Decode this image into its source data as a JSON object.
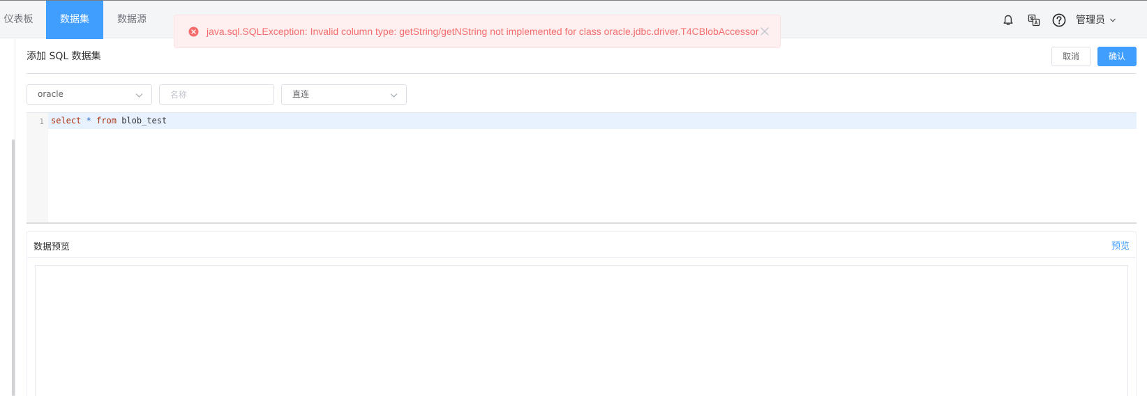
{
  "nav": {
    "tabs": [
      {
        "label": "仪表板",
        "active": false
      },
      {
        "label": "数据集",
        "active": true
      },
      {
        "label": "数据源",
        "active": false
      }
    ]
  },
  "header_tools": {
    "icons": [
      "bell-icon",
      "translate-icon",
      "help-icon"
    ],
    "user_label": "管理员"
  },
  "toast": {
    "type": "error",
    "message": "java.sql.SQLException: Invalid column type: getString/getNString not implemented for class oracle.jdbc.driver.T4CBlobAccessor"
  },
  "page": {
    "title": "添加 SQL 数据集",
    "cancel_label": "取消",
    "confirm_label": "确认"
  },
  "form": {
    "datasource_value": "oracle",
    "name_placeholder": "名称",
    "name_value": "",
    "mode_value": "直连"
  },
  "editor": {
    "line_number": "1",
    "code": {
      "kw1": "select",
      "star": "*",
      "kw2": "from",
      "table": "blob_test"
    }
  },
  "preview": {
    "title": "数据预览",
    "action_label": "预览"
  },
  "colors": {
    "accent": "#409eff",
    "error": "#f56c6c",
    "error_bg": "#fef0f0"
  }
}
